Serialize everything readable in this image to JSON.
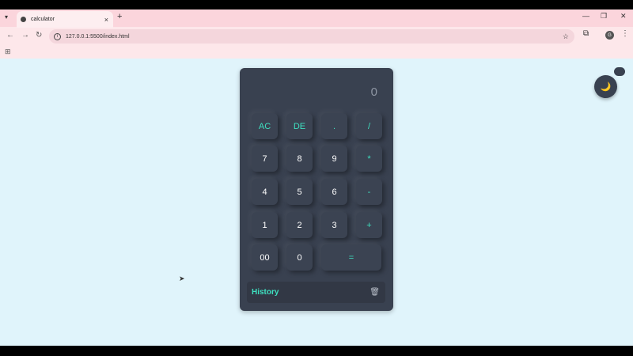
{
  "browser": {
    "tab_title": "calculator",
    "tab_close": "×",
    "tab_list_icon": "▾",
    "new_tab": "+",
    "minimize": "—",
    "restore": "❐",
    "close": "✕",
    "back": "←",
    "forward": "→",
    "reload": "↻",
    "info_icon": "i",
    "url": "127.0.0.1:5500/index.html",
    "star": "☆",
    "extensions": "⧉",
    "profile": "G",
    "menu": "⋮",
    "apps": "⊞"
  },
  "calculator": {
    "display": "0",
    "keys": {
      "ac": "AC",
      "de": "DE",
      "dot": ".",
      "divide": "/",
      "seven": "7",
      "eight": "8",
      "nine": "9",
      "multiply": "*",
      "four": "4",
      "five": "5",
      "six": "6",
      "minus": "-",
      "one": "1",
      "two": "2",
      "three": "3",
      "plus": "+",
      "double_zero": "00",
      "zero": "0",
      "equals": "="
    },
    "history_label": "History",
    "trash_icon": "🗑"
  },
  "theme_toggle_icon": "🌙",
  "accent_color": "#3ee0c0",
  "panel_color": "#394150"
}
